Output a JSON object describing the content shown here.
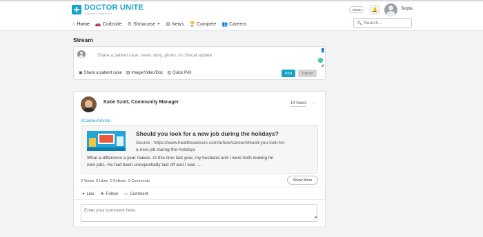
{
  "header": {
    "brand_title": "DOCTOR UNITE",
    "brand_subtitle": "A SKIPTA COMMUNITY",
    "admin_label": "ADMIN",
    "username": "Skipta",
    "search_placeholder": "Search..."
  },
  "nav": [
    {
      "label": "Home",
      "icon": "home-icon",
      "active": true
    },
    {
      "label": "Curbside",
      "icon": "car-icon"
    },
    {
      "label": "Showcase",
      "icon": "gear-icon",
      "dropdown": true
    },
    {
      "label": "News",
      "icon": "news-icon"
    },
    {
      "label": "Compete",
      "icon": "trophy-icon"
    },
    {
      "label": "Careers",
      "icon": "careers-icon"
    }
  ],
  "stream": {
    "title": "Stream",
    "composer": {
      "placeholder": "Share a patient case, news story, photo, or clinical update",
      "actions": [
        {
          "label": "Share a patient case",
          "icon": "patient-case-icon"
        },
        {
          "label": "Image/Video/Doc",
          "icon": "image-icon"
        },
        {
          "label": "Quick Poll",
          "icon": "poll-icon"
        }
      ],
      "post_label": "Post",
      "cancel_label": "Cancel"
    }
  },
  "post": {
    "author": "Katie Szott, Community Manager",
    "time": "14 hours",
    "hashtag": "#CareerAdvice",
    "link": {
      "title": "Should you look for a new job during the holidays?",
      "source_line1": "Source : https://www.healthecareers.com/article/career/should-you-look-for-",
      "source_line2": "a-new-job-during-the-holidays",
      "excerpt_line1": "What a difference a year makes. At this time last year, my husband and I were both looking for",
      "excerpt_line2": "new jobs. He had been unexpectedly laid off and I was ...."
    },
    "stats": {
      "views": "2 Views",
      "likes": "0 Likes",
      "follows": "0 Follows",
      "comments": "0 Comments"
    },
    "show_more_label": "Show More",
    "actions": {
      "like": "Like",
      "follow": "Follow",
      "comment": "Comment"
    },
    "comment_placeholder": "Enter your comment here."
  },
  "colors": {
    "accent": "#17a2c8",
    "page_bg": "#f3f3f3",
    "card_bg": "#ffffff"
  }
}
